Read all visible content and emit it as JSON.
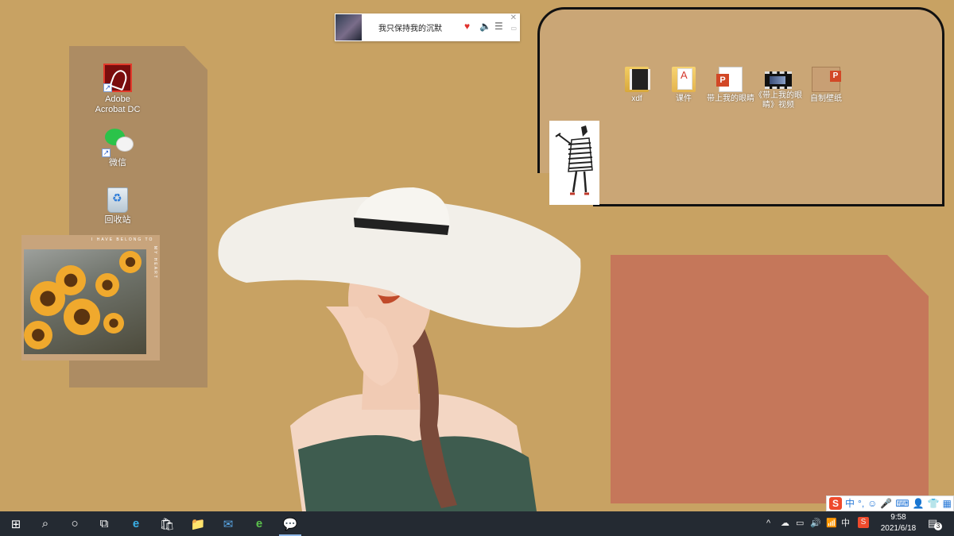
{
  "desktop_icons": [
    {
      "label": "Adobe\nAcrobat DC",
      "icon": "acrobat-icon"
    },
    {
      "label": "微信",
      "icon": "wechat-icon"
    },
    {
      "label": "回收站",
      "icon": "recycle-bin-icon"
    }
  ],
  "frame_icons": [
    {
      "label": "xdf",
      "icon": "folder-icon"
    },
    {
      "label": "课件",
      "icon": "pdf-folder-icon"
    },
    {
      "label": "带上我的眼睛",
      "icon": "pptx-file-icon"
    },
    {
      "label": "《带上我的眼睛》视频",
      "icon": "video-file-icon"
    },
    {
      "label": "自制壁纸",
      "icon": "pptx-wallpaper-icon"
    }
  ],
  "photo_widget": {
    "caption": "I HAVE BELONG TO",
    "side": "MY HEART"
  },
  "music_player": {
    "song": "我只保持我的沉默",
    "like_icon": "heart-icon",
    "volume_icon": "speaker-icon",
    "list_icon": "playlist-icon",
    "close": "✕",
    "mini": "▭"
  },
  "ime_toolbar": {
    "logo": "S",
    "lang": "中",
    "punct": "°,",
    "emoji": "☺",
    "mic": "🎤",
    "keyboard": "⌨",
    "user": "👤",
    "skin": "👕",
    "grid": "▦"
  },
  "taskbar": {
    "start": "⊞",
    "search": "⌕",
    "cortana": "○",
    "taskview": "⧉",
    "apps": [
      {
        "name": "edge",
        "glyph": "e"
      },
      {
        "name": "store",
        "glyph": "🛍"
      },
      {
        "name": "explorer",
        "glyph": "📁"
      },
      {
        "name": "mail",
        "glyph": "✉"
      },
      {
        "name": "browser-360",
        "glyph": "e"
      },
      {
        "name": "wechat",
        "glyph": "💬"
      }
    ],
    "tray": {
      "chevron": "^",
      "volume": "🔊",
      "wifi": "📶",
      "ime": "中",
      "sogou": "S"
    },
    "time": "9:58",
    "date": "2021/6/18",
    "notification_count": "3"
  },
  "colors": {
    "background": "#c8a263",
    "left_panel": "#ad8c63",
    "orange_panel": "#c5775a",
    "taskbar": "#242a32"
  }
}
